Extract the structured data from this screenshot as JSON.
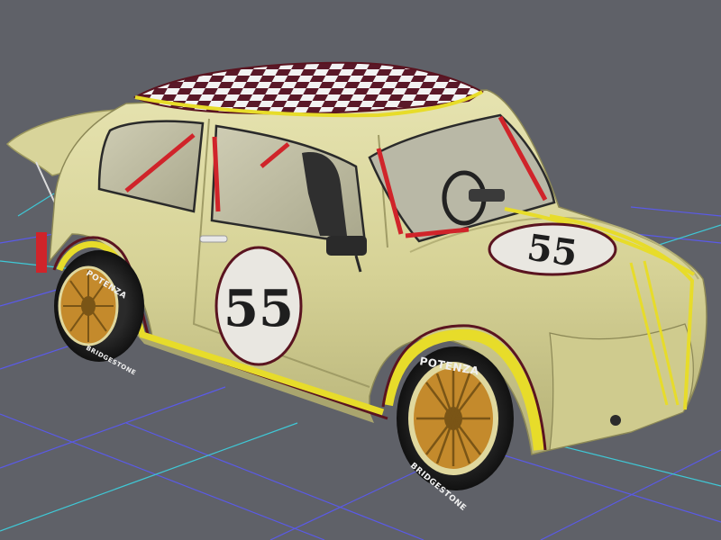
{
  "viewport": {
    "name": "3d-model-viewport",
    "background_color": "#5f6168",
    "grid_color_blue": "#5a5ae8",
    "grid_color_cyan": "#3fc8d6"
  },
  "car": {
    "body_color": "#d8d49a",
    "stripe_color": "#e7dc2a",
    "trim_color": "#5a1420",
    "roof_check_dark": "#5a1828",
    "roof_check_light": "#f2f2f2",
    "roll_cage_color": "#d0242a",
    "race_number": "55",
    "tire_brand": "POTENZA",
    "tire_maker": "BRIDGESTONE",
    "wheel_color": "#c48a2c"
  }
}
